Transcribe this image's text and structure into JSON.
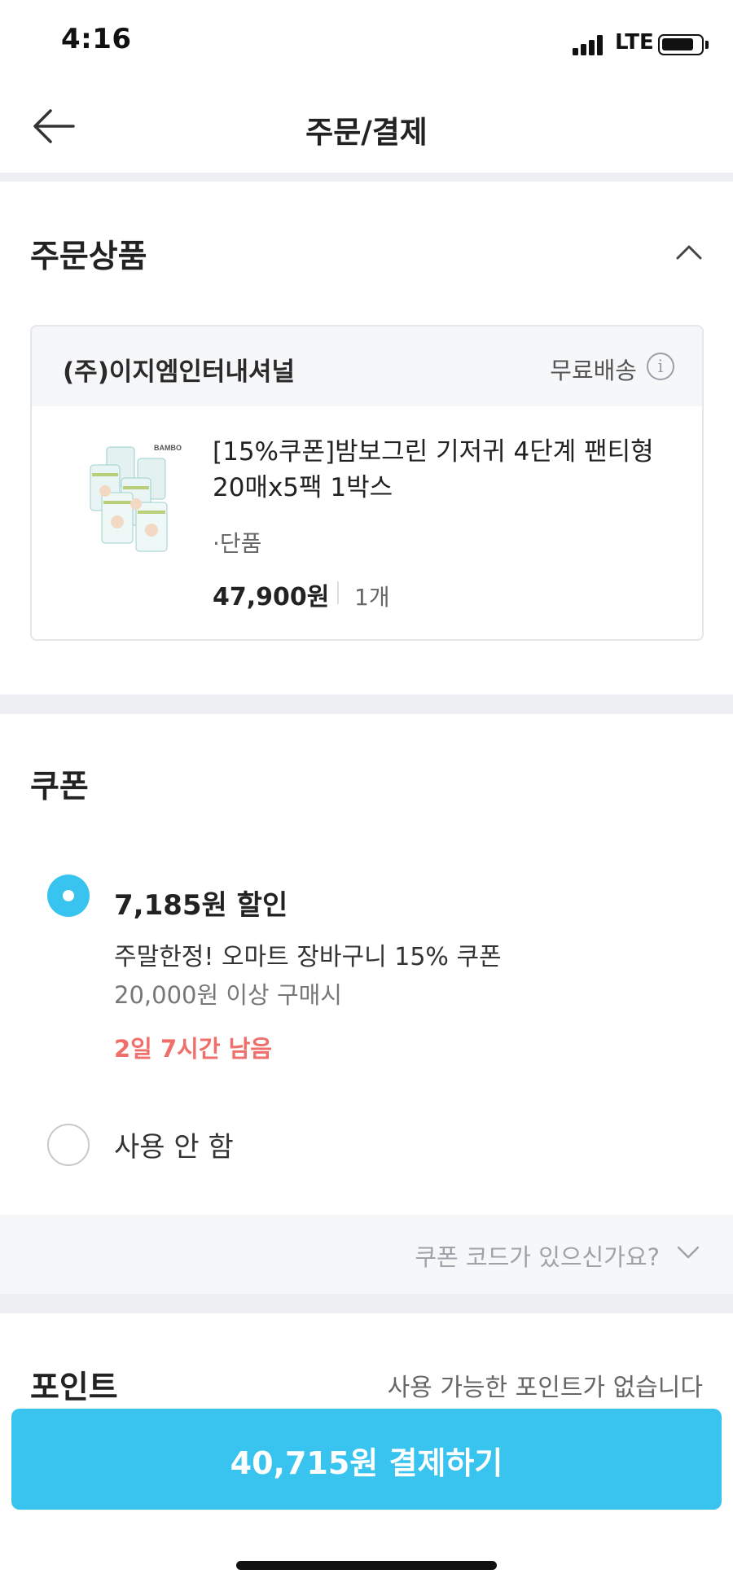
{
  "status_bar": {
    "time": "4:16",
    "network": "LTE"
  },
  "nav": {
    "title": "주문/결제",
    "back_icon": "arrow-left-icon"
  },
  "order_section": {
    "title": "주문상품",
    "collapse_icon": "chevron-up-icon",
    "seller": {
      "name": "(주)이지엠인터내셔널",
      "shipping": "무료배송",
      "info_icon": "info-icon"
    },
    "product": {
      "name": "[15%쿠폰]밤보그린 기저귀 4단계 팬티형 20매x5팩 1박스",
      "option": "·단품",
      "price": "47,900원",
      "quantity": "1개",
      "thumbnail_brand": "BAMBO"
    }
  },
  "coupon_section": {
    "title": "쿠폰",
    "options": [
      {
        "selected": true,
        "amount": "7,185원 할인",
        "name": "주말한정! 오마트 장바구니 15% 쿠폰",
        "condition": "20,000원 이상 구매시",
        "remaining": "2일 7시간 남음"
      },
      {
        "selected": false,
        "label": "사용 안 함"
      }
    ],
    "code_prompt": "쿠폰 코드가 있으신가요?",
    "code_icon": "chevron-down-icon"
  },
  "point_section": {
    "title": "포인트",
    "status": "사용 가능한 포인트가 없습니다"
  },
  "pay_button": {
    "label": "40,715원 결제하기"
  },
  "colors": {
    "accent": "#38c4ee",
    "remaining_text": "#ef6f6a",
    "divider": "#eeeff2",
    "panel_bg": "#f6f7f9"
  }
}
